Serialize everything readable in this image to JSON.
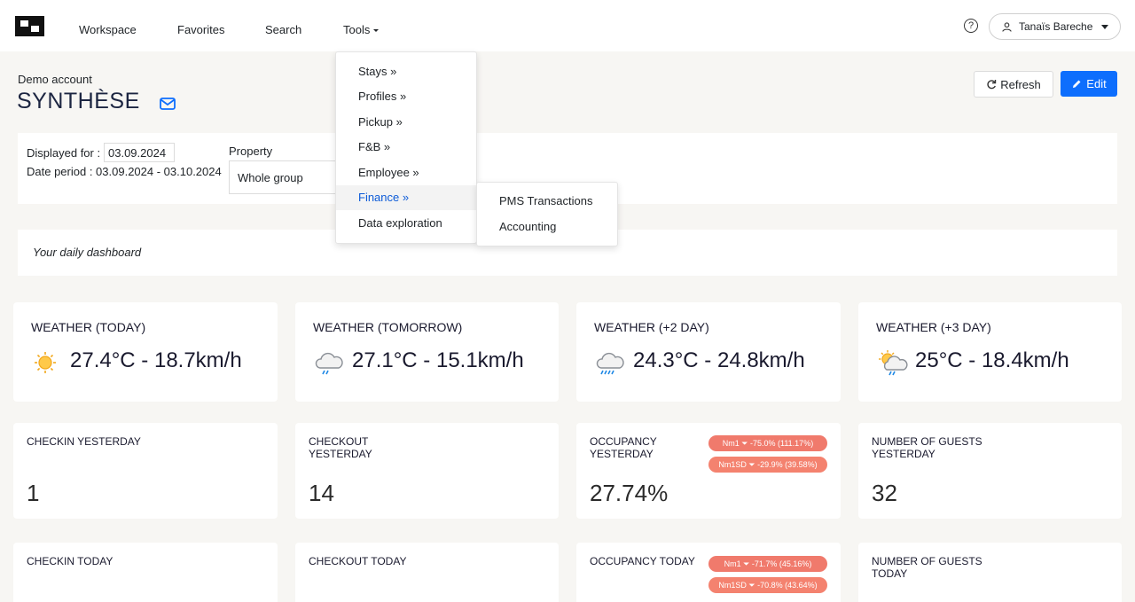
{
  "nav": {
    "items": [
      {
        "label": "Workspace"
      },
      {
        "label": "Favorites"
      },
      {
        "label": "Search"
      },
      {
        "label": "Tools"
      }
    ],
    "help_icon": "question-circle-icon",
    "help_glyph": "?",
    "user_name": "Tanaïs Bareche"
  },
  "header": {
    "account": "Demo account",
    "title": "SYNTHÈSE",
    "refresh_label": "Refresh",
    "edit_label": "Edit"
  },
  "filters": {
    "displayed_for_label": "Displayed for :",
    "date_value": "03.09.2024",
    "period_label": "Date period : 03.09.2024 - 03.10.2024",
    "property_label": "Property",
    "property_value": "Whole group"
  },
  "daily": {
    "text": "Your daily dashboard"
  },
  "tools_menu": {
    "items": [
      {
        "label": "Stays »"
      },
      {
        "label": "Profiles »"
      },
      {
        "label": "Pickup »"
      },
      {
        "label": "F&B »"
      },
      {
        "label": "Employee »"
      },
      {
        "label": "Finance »"
      },
      {
        "label": "Data exploration"
      }
    ],
    "active_index": 5
  },
  "finance_menu": {
    "items": [
      {
        "label": "PMS Transactions"
      },
      {
        "label": "Accounting"
      }
    ]
  },
  "weather": [
    {
      "title": "WEATHER (TODAY)",
      "value": "27.4°C - 18.7km/h",
      "icon": "sun-icon"
    },
    {
      "title": "WEATHER (TOMORROW)",
      "value": "27.1°C - 15.1km/h",
      "icon": "rain-cloud-icon"
    },
    {
      "title": "WEATHER (+2 DAY)",
      "value": "24.3°C - 24.8km/h",
      "icon": "heavy-rain-cloud-icon"
    },
    {
      "title": "WEATHER (+3 DAY)",
      "value": "25°C - 18.4km/h",
      "icon": "sun-cloud-rain-icon"
    }
  ],
  "kpi_yesterday": [
    {
      "title": "CHECKIN YESTERDAY",
      "value": "1"
    },
    {
      "title": "CHECKOUT YESTERDAY",
      "value": "14"
    },
    {
      "title": "OCCUPANCY YESTERDAY",
      "value": "27.74%",
      "badges": [
        "Nm1 ⏷ -75.0% (111.17%)",
        "Nm1SD ⏷ -29.9% (39.58%)"
      ]
    },
    {
      "title": "NUMBER OF GUESTS YESTERDAY",
      "value": "32"
    }
  ],
  "kpi_today": [
    {
      "title": "CHECKIN TODAY"
    },
    {
      "title": "CHECKOUT TODAY"
    },
    {
      "title": "OCCUPANCY TODAY",
      "badges": [
        "Nm1 ⏷ -71.7% (45.16%)",
        "Nm1SD ⏷ -70.8% (43.64%)"
      ]
    },
    {
      "title": "NUMBER OF GUESTS TODAY"
    }
  ],
  "colors": {
    "accent": "#0d6efd",
    "badge": "#f07a6c",
    "title": "#1c2541"
  }
}
